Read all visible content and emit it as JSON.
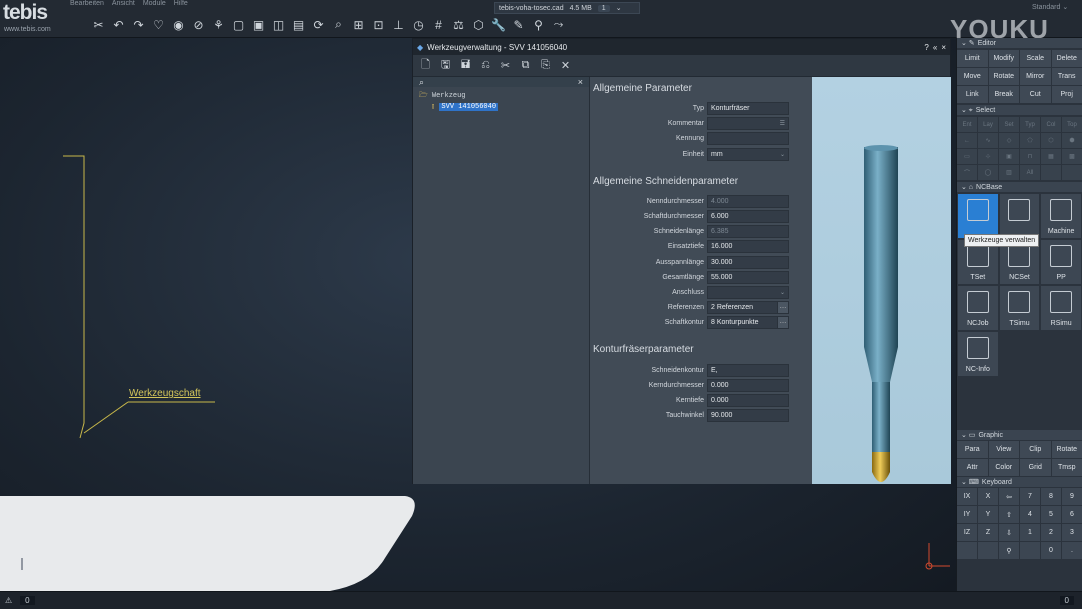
{
  "app": {
    "logo": "tebis",
    "logo_sub": "www.tebis.com",
    "menu": [
      "Bearbeiten",
      "Ansicht",
      "Module",
      "Hilfe"
    ],
    "doc_tab": {
      "name": "tebis-voha-tosec.cad",
      "size": "4.5 MB",
      "page": "1"
    },
    "layout": "Standard",
    "watermark": "YOUKU"
  },
  "viewport": {
    "annotation": "Werkzeugschaft"
  },
  "dialog": {
    "title": "Werkzeugverwaltung - SVV 141056040",
    "title_buttons": [
      "?",
      "«",
      "×"
    ],
    "tree": {
      "root": "Werkzeug",
      "child": "SVV 141056040",
      "clear": "×"
    },
    "sections": [
      {
        "title": "Allgemeine Parameter",
        "rows": [
          {
            "label": "Typ",
            "value": "Konturfräser"
          },
          {
            "label": "Kommentar",
            "value": ""
          },
          {
            "label": "Kennung",
            "value": ""
          },
          {
            "label": "Einheit",
            "value": "mm"
          }
        ]
      },
      {
        "title": "Allgemeine Schneidenparameter",
        "rows": [
          {
            "label": "Nenndurchmesser",
            "value": "4.000"
          },
          {
            "label": "Schaftdurchmesser",
            "value": "6.000"
          },
          {
            "label": "Schneidenlänge",
            "value": "6.385"
          },
          {
            "label": "Einsatztiefe",
            "value": "16.000"
          },
          {
            "label": "Ausspannlänge",
            "value": "30.000"
          },
          {
            "label": "Gesamtlänge",
            "value": "55.000"
          },
          {
            "label": "Anschluss",
            "value": ""
          },
          {
            "label": "Referenzen",
            "value": "2 Referenzen"
          },
          {
            "label": "Schaftkontur",
            "value": "8 Konturpunkte"
          }
        ]
      },
      {
        "title": "Konturfräserparameter",
        "rows": [
          {
            "label": "Schneidenkontur",
            "value": "E,"
          },
          {
            "label": "Kerndurchmesser",
            "value": "0.000"
          },
          {
            "label": "Kerntiefe",
            "value": "0.000"
          },
          {
            "label": "Tauchwinkel",
            "value": "90.000"
          }
        ]
      }
    ]
  },
  "panel": {
    "editor": {
      "title": "Editor",
      "buttons": [
        "Limit",
        "Modify",
        "Scale",
        "Delete",
        "Move",
        "Rotate",
        "Mirror",
        "Trans",
        "Link",
        "Break",
        "Cut",
        "Proj"
      ]
    },
    "select": {
      "title": "Select",
      "tabs": [
        "Ent",
        "Lay",
        "Set",
        "Typ",
        "Col",
        "Top"
      ],
      "all": "All"
    },
    "ncbase": {
      "title": "NCBase",
      "items": [
        "",
        "",
        "Machine",
        "TSet",
        "NCSet",
        "PP",
        "NCJob",
        "TSimu",
        "RSimu",
        "NC-Info"
      ],
      "tooltip": "Werkzeuge verwalten"
    },
    "graphic": {
      "title": "Graphic",
      "buttons": [
        "Para",
        "View",
        "Clip",
        "Rotate",
        "Attr",
        "Color",
        "Grid",
        "Tmsp"
      ]
    },
    "keyboard": {
      "title": "Keyboard",
      "keys": [
        "IX",
        "X",
        "⇦",
        "7",
        "8",
        "9",
        "IY",
        "Y",
        "⇧",
        "4",
        "5",
        "6",
        "IZ",
        "Z",
        "⇩",
        "1",
        "2",
        "3",
        "",
        "",
        "⚲",
        "",
        "0",
        "."
      ]
    }
  },
  "status": {
    "left_value": "0",
    "right_value": "0"
  }
}
